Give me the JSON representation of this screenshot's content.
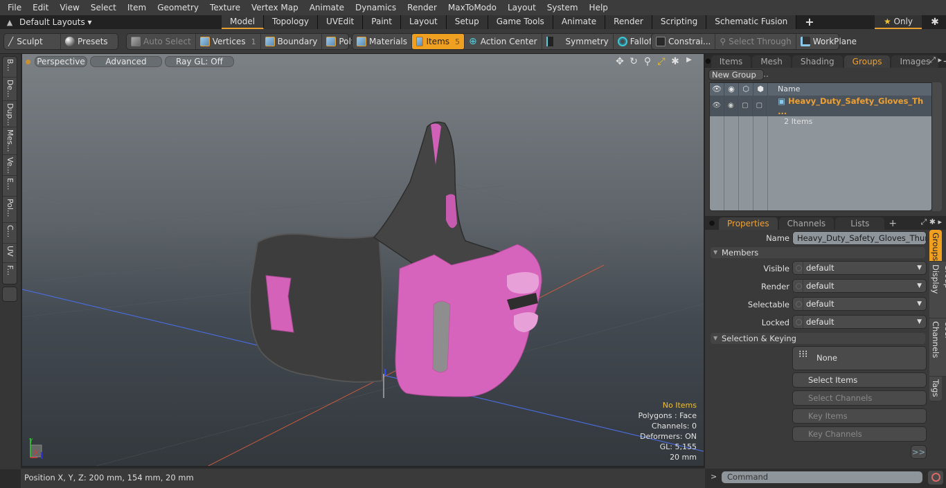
{
  "menu": [
    "File",
    "Edit",
    "View",
    "Select",
    "Item",
    "Geometry",
    "Texture",
    "Vertex Map",
    "Animate",
    "Dynamics",
    "Render",
    "MaxToModo",
    "Layout",
    "System",
    "Help"
  ],
  "layouts": {
    "label": "Default Layouts ▾"
  },
  "mode_tabs": [
    {
      "label": "Model",
      "active": true
    },
    {
      "label": "Topology"
    },
    {
      "label": "UVEdit"
    },
    {
      "label": "Paint"
    },
    {
      "label": "Layout"
    },
    {
      "label": "Setup"
    },
    {
      "label": "Game Tools"
    },
    {
      "label": "Animate"
    },
    {
      "label": "Render"
    },
    {
      "label": "Scripting"
    },
    {
      "label": "Schematic Fusion"
    }
  ],
  "only_button": {
    "label": "Only"
  },
  "toolbar": {
    "sculpt": "Sculpt",
    "presets": "Presets",
    "auto_select": "Auto Select",
    "vertices": "Vertices",
    "vertices_count": "1",
    "boundary": "Boundary",
    "polygons": "Polygons",
    "materials": "Materials",
    "items": "Items",
    "items_count": "5",
    "action_center": "Action Center",
    "symmetry": "Symmetry",
    "falloff": "Falloff",
    "constraints": "Constrai...",
    "select_through": "Select Through",
    "workplane": "WorkPlane"
  },
  "left_tabs": [
    "B...",
    "De...",
    "Dup...",
    "Mes...",
    "Ve...",
    "E...",
    "Pol...",
    "C...",
    "UV",
    "F..."
  ],
  "viewport": {
    "view": "Perspective",
    "shading": "Advanced",
    "raygl": "Ray GL: Off",
    "info": {
      "items": "No Items",
      "polygons": "Polygons : Face",
      "channels": "Channels: 0",
      "deformers": "Deformers: ON",
      "gl": "GL: 5,155",
      "scale": "20 mm"
    }
  },
  "status": {
    "position": "Position X, Y, Z:   200 mm, 154 mm, 20 mm"
  },
  "top_panel": {
    "tabs": [
      {
        "label": "Items"
      },
      {
        "label": "Mesh ..."
      },
      {
        "label": "Shading"
      },
      {
        "label": "Groups",
        "active": true
      },
      {
        "label": "Images"
      }
    ],
    "new_group": "New Group",
    "col_name": "Name",
    "group": {
      "name": "Heavy_Duty_Safety_Gloves_Th ...",
      "count": "2 Items"
    }
  },
  "props_panel": {
    "tabs": [
      {
        "label": "Properties",
        "active": true
      },
      {
        "label": "Channels"
      },
      {
        "label": "Lists"
      }
    ],
    "name_label": "Name",
    "name_value": "Heavy_Duty_Safety_Gloves_Thumbs_",
    "members": "Members",
    "fields": [
      {
        "label": "Visible",
        "value": "default"
      },
      {
        "label": "Render",
        "value": "default"
      },
      {
        "label": "Selectable",
        "value": "default"
      },
      {
        "label": "Locked",
        "value": "default"
      }
    ],
    "sel_keying": "Selection & Keying",
    "none": "None",
    "select_items": "Select Items",
    "select_channels": "Select Channels",
    "key_items": "Key Items",
    "key_channels": "Key Channels",
    "more": ">>",
    "side_tabs": [
      "Groups",
      "Group Display",
      "User Channels",
      "Tags"
    ]
  },
  "command": {
    "placeholder": "Command",
    "prompt": ">"
  }
}
